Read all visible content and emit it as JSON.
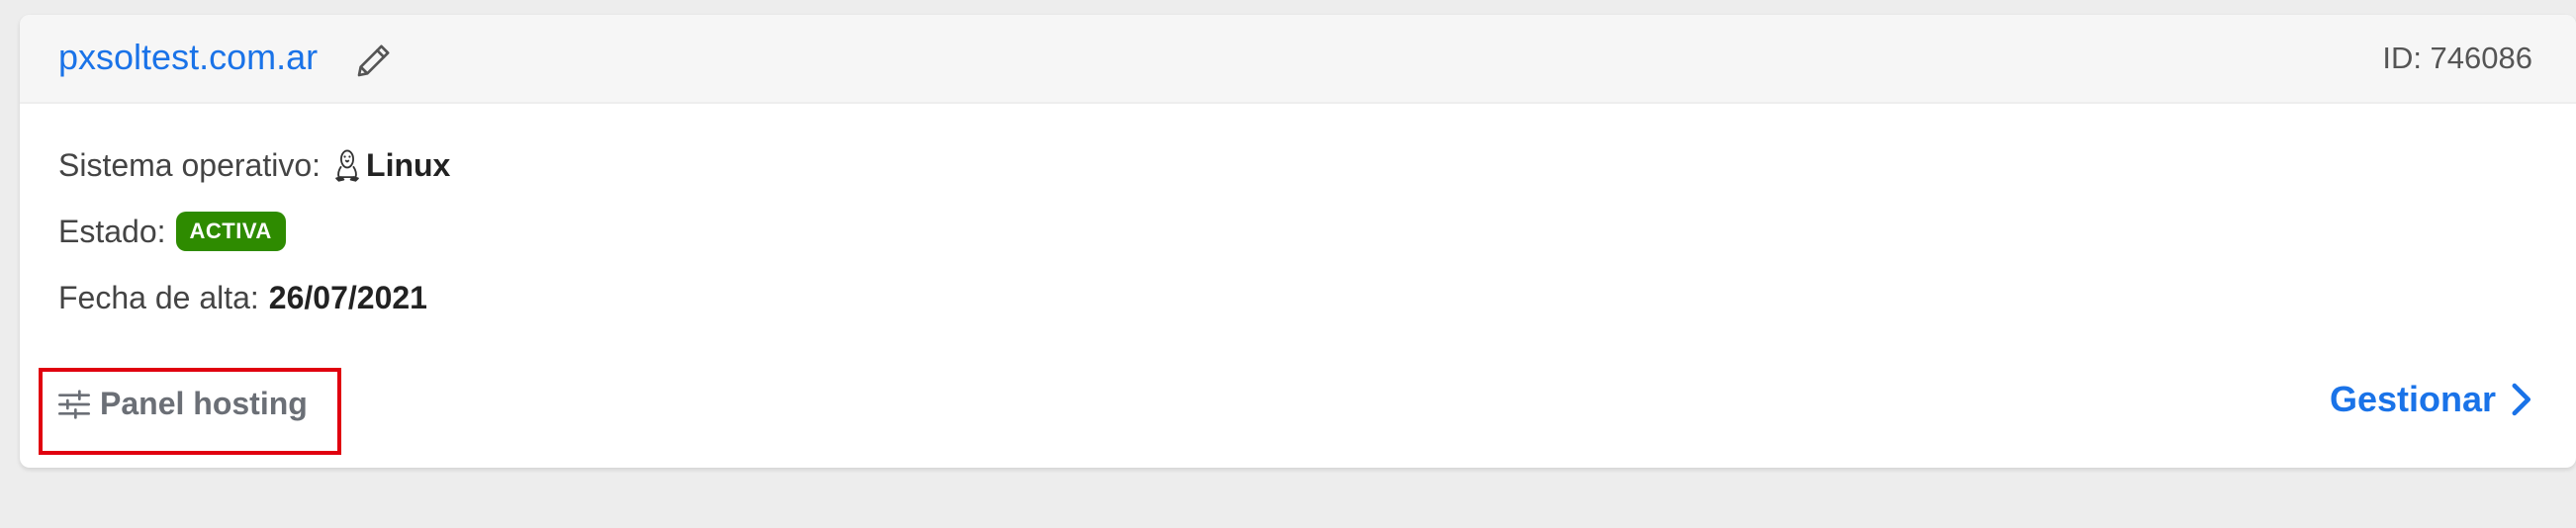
{
  "service": {
    "domain": "pxsoltest.com.ar",
    "id_text": "ID: 746086"
  },
  "details": {
    "os_label": "Sistema operativo:",
    "os_value": "Linux",
    "state_label": "Estado:",
    "state_value": "ACTIVA",
    "date_label": "Fecha de alta:",
    "date_value": "26/07/2021"
  },
  "actions": {
    "panel_label": "Panel hosting",
    "manage_label": "Gestionar"
  },
  "colors": {
    "link": "#1a73e8",
    "status_active": "#2e8b00",
    "highlight": "#e0000f"
  },
  "icons": {
    "edit": "pencil-icon",
    "os": "tux-linux-icon",
    "panel": "sliders-icon",
    "manage": "chevron-right-icon"
  }
}
